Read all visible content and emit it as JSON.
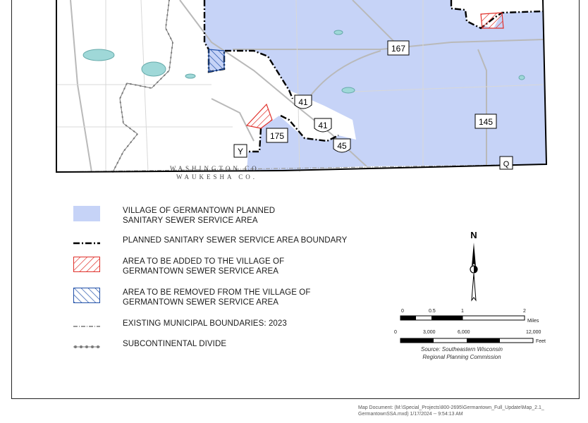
{
  "map": {
    "county_labels": [
      "WASHINGTON CO.",
      "WAUKESHA CO."
    ],
    "route_shields": [
      "167",
      "41",
      "41",
      "45",
      "175",
      "145",
      "Y",
      "Q"
    ]
  },
  "legend": {
    "items": [
      {
        "id": "planned-area",
        "lines": [
          "VILLAGE OF GERMANTOWN PLANNED",
          "SANITARY SEWER SERVICE AREA"
        ],
        "color": "#c6d3f7"
      },
      {
        "id": "boundary",
        "lines": [
          "PLANNED SANITARY SEWER SERVICE AREA BOUNDARY"
        ],
        "color": "#000000"
      },
      {
        "id": "to-add",
        "lines": [
          "AREA TO BE ADDED TO THE VILLAGE OF",
          "GERMANTOWN SEWER SERVICE AREA"
        ],
        "color": "#e0302a"
      },
      {
        "id": "to-remove",
        "lines": [
          "AREA TO BE REMOVED FROM THE VILLAGE OF",
          "GERMANTOWN SEWER SERVICE AREA"
        ],
        "color": "#1f4fa8"
      },
      {
        "id": "municipal",
        "lines": [
          "EXISTING MUNICIPAL BOUNDARIES: 2023"
        ],
        "color": "#9a9a9a"
      },
      {
        "id": "divide",
        "lines": [
          "SUBCONTINENTAL DIVIDE"
        ],
        "color": "#7a7a7a"
      }
    ]
  },
  "north_arrow": {
    "label": "N"
  },
  "scale": {
    "miles_ticks": [
      "0",
      "0.5",
      "1",
      "2"
    ],
    "miles_unit": "Miles",
    "feet_ticks": [
      "0",
      "3,000",
      "6,000",
      "12,000"
    ],
    "feet_unit": "Feet"
  },
  "source": [
    "Source: Southeastern Wisconsin",
    "Regional Planning Commission"
  ],
  "map_document": [
    "Map Document: (M:\\Special_Projects\\800-2695\\Germantown_Full_Update\\Map_2.1_",
    "GermantownSSA.mxd) 1/17/2024 -- 9:54:13 AM"
  ]
}
